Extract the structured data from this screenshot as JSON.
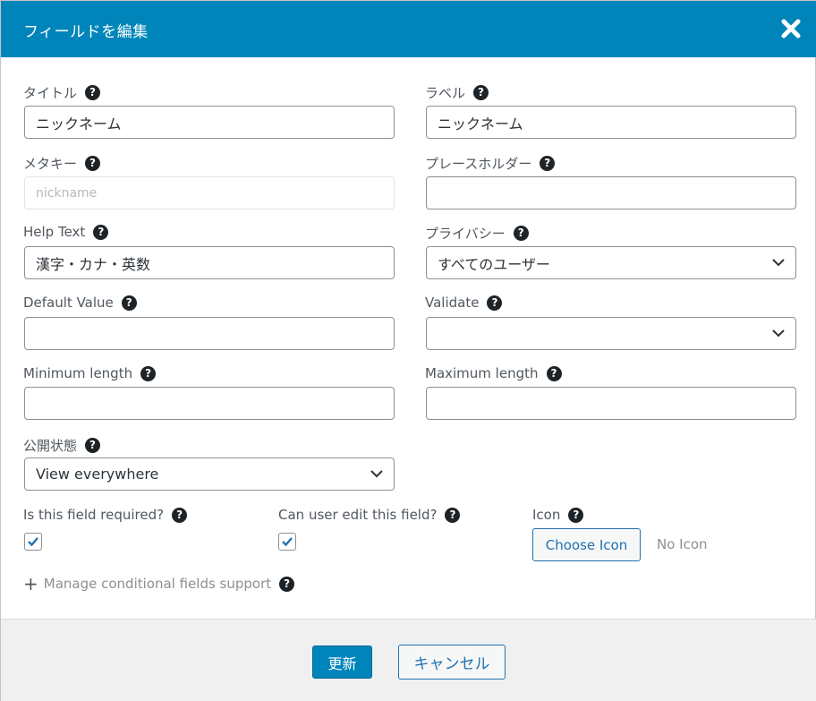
{
  "dialog": {
    "title": "フィールドを編集",
    "close_icon": "close-x-icon"
  },
  "fields": {
    "title": {
      "label": "タイトル",
      "value": "ニックネーム"
    },
    "label": {
      "label": "ラベル",
      "value": "ニックネーム"
    },
    "meta_key": {
      "label": "メタキー",
      "value": "nickname"
    },
    "placeholder": {
      "label": "プレースホルダー",
      "value": ""
    },
    "help_text": {
      "label": "Help Text",
      "value": "漢字・カナ・英数"
    },
    "privacy": {
      "label": "プライバシー",
      "selected": "すべてのユーザー"
    },
    "default_value": {
      "label": "Default Value",
      "value": ""
    },
    "validate": {
      "label": "Validate",
      "selected": ""
    },
    "minimum_length": {
      "label": "Minimum length",
      "value": ""
    },
    "maximum_length": {
      "label": "Maximum length",
      "value": ""
    },
    "visibility": {
      "label": "公開状態",
      "selected": "View everywhere"
    },
    "required": {
      "label": "Is this field required?",
      "checked": true
    },
    "editable": {
      "label": "Can user edit this field?",
      "checked": true
    },
    "icon": {
      "label": "Icon",
      "button": "Choose Icon",
      "status": "No Icon"
    }
  },
  "conditional": {
    "plus": "+",
    "label": "Manage conditional fields support"
  },
  "footer": {
    "update_label": "更新",
    "cancel_label": "キャンセル"
  },
  "help_glyph": "?",
  "colors": {
    "header": "#0085ba",
    "primary_button": "#0085ba",
    "accent": "#2271b1",
    "footer_bg": "#f0f0f1"
  }
}
